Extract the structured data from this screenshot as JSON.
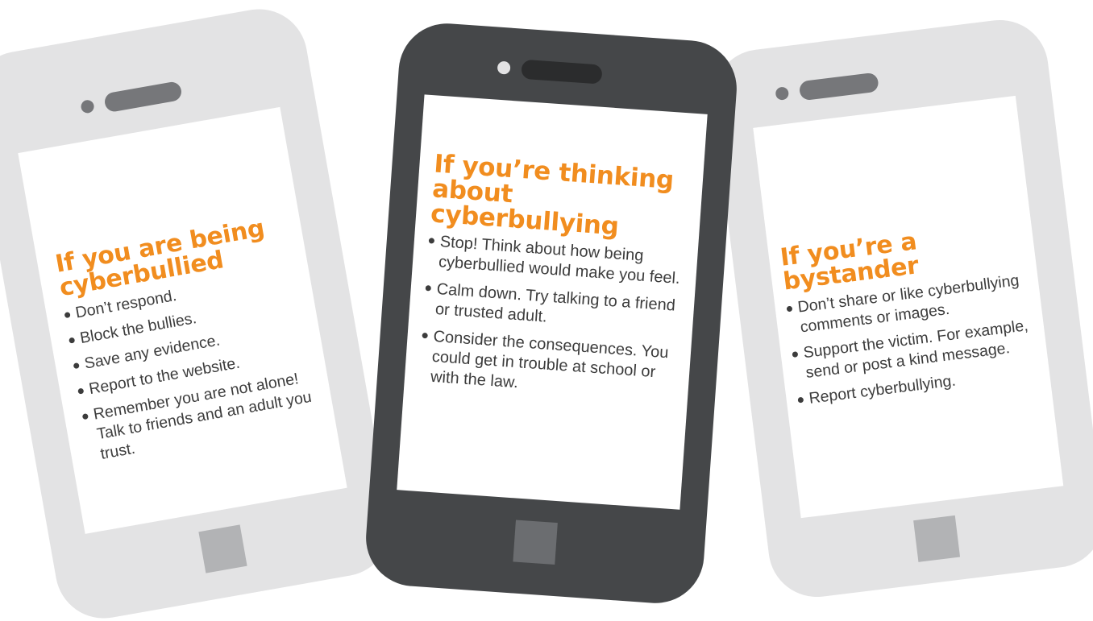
{
  "colors": {
    "accent_orange": "#f18d1f",
    "body_text": "#3c3c3c",
    "light_phone": "#e3e3e4",
    "dark_phone": "#454749",
    "screen": "#ffffff"
  },
  "cards": [
    {
      "title_line1": "If you are being",
      "title_line2": "cyberbullied",
      "tips": [
        "Don’t respond.",
        "Block the bullies.",
        "Save any evidence.",
        "Report to the website.",
        "Remember you are not alone! Talk to friends and an adult you trust."
      ]
    },
    {
      "title_line1": "If you’re thinking",
      "title_line2": "about cyberbullying",
      "tips": [
        "Stop! Think about how being cyberbullied would make you feel.",
        "Calm down. Try talking to a friend or trusted adult.",
        "Consider the consequences. You could get in trouble at school or with the law."
      ]
    },
    {
      "title_line1": "If you’re a bystander",
      "tips": [
        "Don’t share or like cyberbullying comments or images.",
        "Support the victim. For example, send or post a kind message.",
        "Report cyberbullying."
      ]
    }
  ]
}
